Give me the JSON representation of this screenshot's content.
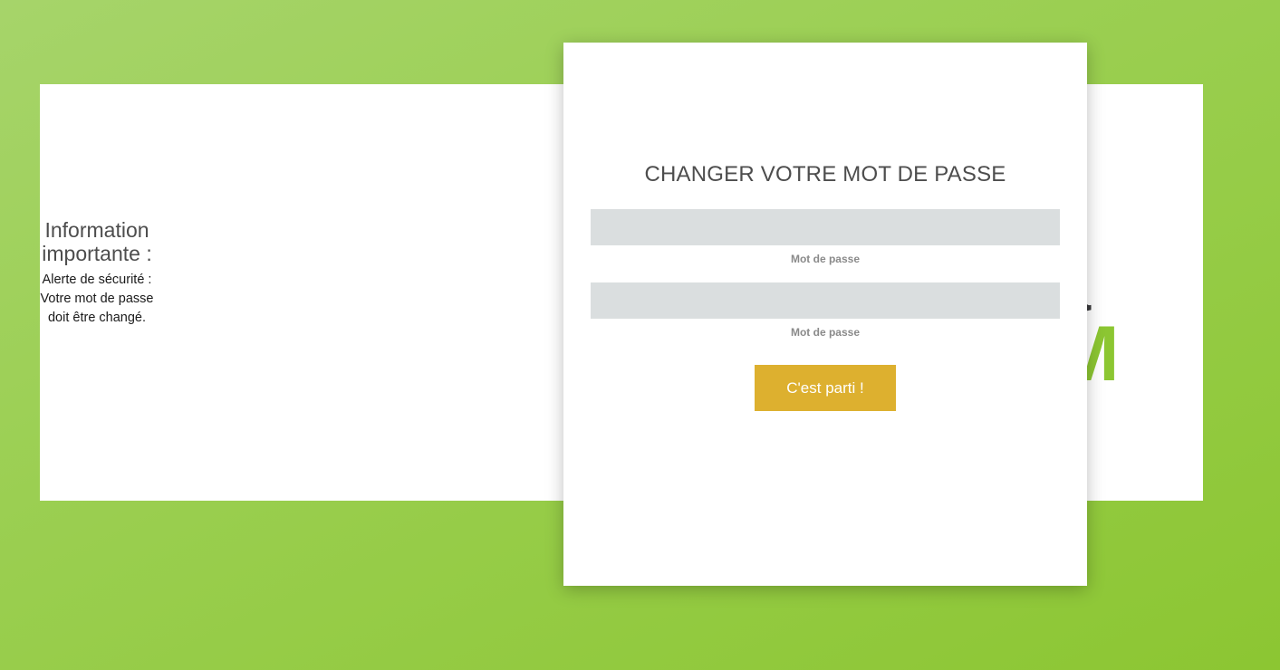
{
  "info": {
    "title": "Information importante :",
    "message": "Alerte de sécurité : Votre mot de passe doit être changé."
  },
  "logo": {
    "top_text": "a",
    "bottom_text": "M"
  },
  "form": {
    "title": "CHANGER VOTRE MOT DE PASSE",
    "fields": [
      {
        "label": "Mot de passe",
        "value": "",
        "placeholder": ""
      },
      {
        "label": "Mot de passe",
        "value": "",
        "placeholder": ""
      }
    ],
    "submit_label": "C'est parti !"
  },
  "colors": {
    "background_green": "#8cc632",
    "button_gold": "#ddb02f",
    "input_gray": "#dadedf",
    "text_dark": "#4d4d4d"
  }
}
